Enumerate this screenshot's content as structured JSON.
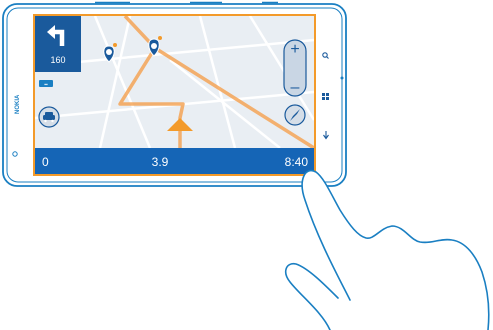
{
  "device": {
    "brand_logo": "NOKIA"
  },
  "nav": {
    "distance_to_turn": "160"
  },
  "status_bar": {
    "left_value": "0",
    "center_value": "3.9",
    "right_value": "8:40"
  },
  "colors": {
    "accent_blue": "#1a7fc2",
    "status_bar_blue": "#1565b6",
    "turn_panel_blue": "#1a5a9c",
    "map_background": "#e9eef3",
    "route_orange": "#f5a04d",
    "screen_outline": "#f39a2a"
  },
  "icons": {
    "turn": "turn-left-arrow-icon",
    "poi": "location-pin-icon",
    "traffic": "traffic-car-icon",
    "car_position": "car-position-arrow-icon",
    "compass": "compass-icon",
    "search": "search-icon",
    "home": "windows-home-icon",
    "back": "back-arrow-icon",
    "hand": "finger-swipe-gesture-icon"
  }
}
